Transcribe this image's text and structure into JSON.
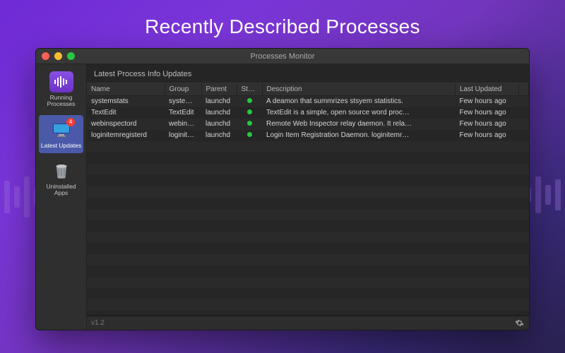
{
  "hero_title": "Recently Described Processes",
  "window": {
    "title": "Processes Monitor"
  },
  "version": "v1.2",
  "colors": {
    "status_ok": "#28c840",
    "badge": "#ff3b30",
    "accent": "#7a35d8"
  },
  "sidebar": {
    "items": [
      {
        "id": "running-processes",
        "label": "Running Processes",
        "icon": "soundbars-icon",
        "active": false,
        "badge": null
      },
      {
        "id": "latest-updates",
        "label": "Latest Updates",
        "icon": "monitor-icon",
        "active": true,
        "badge": "4"
      },
      {
        "id": "uninstalled-apps",
        "label": "Uninstalled Apps",
        "icon": "trash-icon",
        "active": false,
        "badge": null
      }
    ]
  },
  "panel": {
    "title": "Latest Process Info Updates"
  },
  "table": {
    "columns": [
      "Name",
      "Group",
      "Parent",
      "Status",
      "Description",
      "Last Updated"
    ],
    "rows": [
      {
        "name": "systemstats",
        "group": "system…",
        "parent": "launchd",
        "status": "ok",
        "description": "A deamon that summrizes stsyem statistics.",
        "updated": "Few hours ago"
      },
      {
        "name": "TextEdit",
        "group": "TextEdit",
        "parent": "launchd",
        "status": "ok",
        "description": "TextEdit is a simple, open source word proc…",
        "updated": "Few hours ago"
      },
      {
        "name": "webinspectord",
        "group": "webins…",
        "parent": "launchd",
        "status": "ok",
        "description": "Remote Web Inspector relay daemon. It rela…",
        "updated": "Few hours ago"
      },
      {
        "name": "loginitemregisterd",
        "group": "loginite…",
        "parent": "launchd",
        "status": "ok",
        "description": "Login Item Registration Daemon. loginitemr…",
        "updated": "Few hours ago"
      }
    ],
    "empty_row_count": 17
  }
}
